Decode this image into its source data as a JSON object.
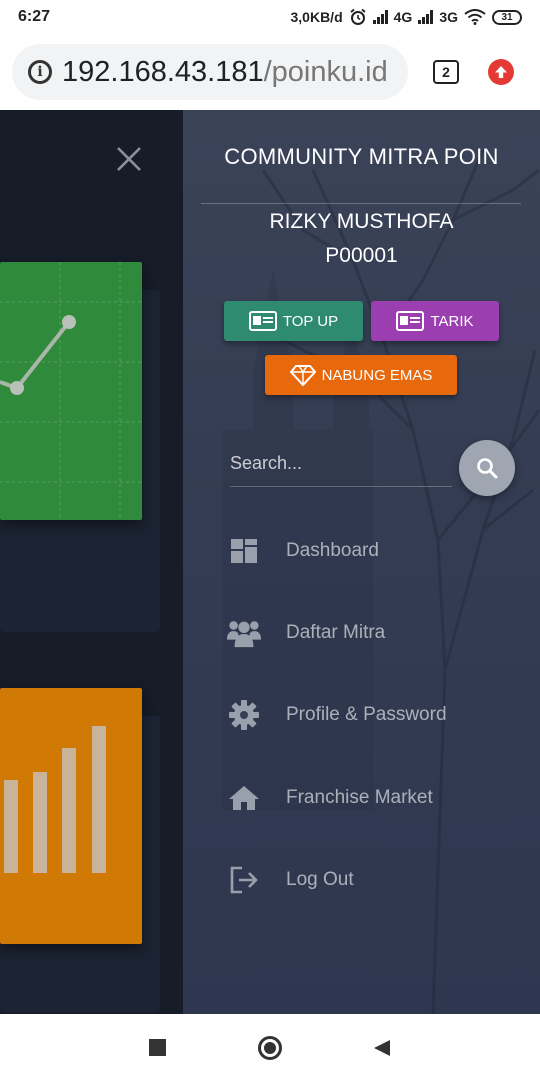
{
  "status_bar": {
    "time": "6:27",
    "speed": "3,0KB/d",
    "network1": "4G",
    "network2": "3G",
    "battery": "31"
  },
  "browser": {
    "url_host": "192.168.43.181",
    "url_path": "/poinku.id",
    "tab_count": "2"
  },
  "sidebar": {
    "title": "COMMUNITY MITRA POIN",
    "user_name": "RIZKY MUSTHOFA",
    "user_id": "P00001",
    "buttons": {
      "topup": "TOP UP",
      "tarik": "TARIK",
      "nabung_emas": "NABUNG EMAS"
    },
    "search": {
      "placeholder": "Search..."
    },
    "menu": [
      {
        "label": "Dashboard",
        "icon": "dashboard-icon"
      },
      {
        "label": "Daftar Mitra",
        "icon": "users-icon"
      },
      {
        "label": "Profile & Password",
        "icon": "gear-icon"
      },
      {
        "label": "Franchise Market",
        "icon": "home-icon"
      },
      {
        "label": "Log Out",
        "icon": "logout-icon"
      }
    ]
  },
  "colors": {
    "topup": "#2e8b70",
    "tarik": "#9b3fb0",
    "nabung_emas": "#e8690b",
    "green_card": "#2f8a3c",
    "orange_card": "#d07a05"
  }
}
